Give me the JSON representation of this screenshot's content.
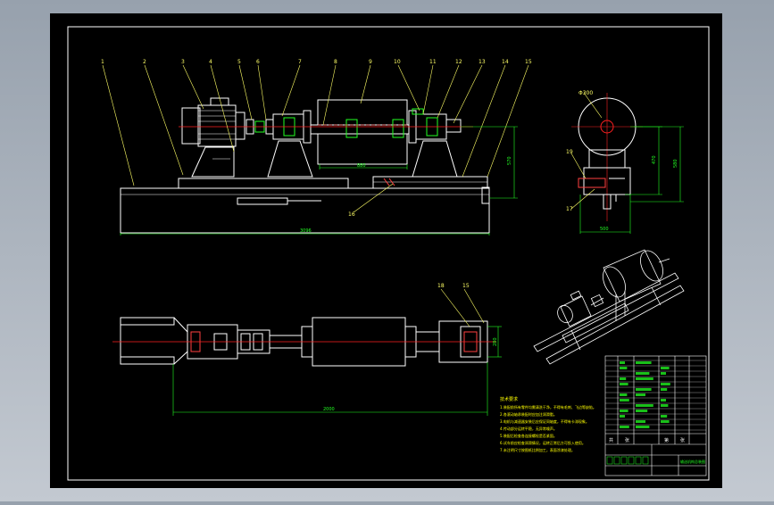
{
  "colors": {
    "background": "#9aa3ae",
    "sheet": "#000000",
    "line": "#ffffff",
    "centerline": "#ff2020",
    "leader": "#ffff66",
    "dimension": "#22ff22",
    "annotation": "#ffff00"
  },
  "drawing": {
    "balloons": [
      "1",
      "2",
      "3",
      "4",
      "5",
      "6",
      "7",
      "8",
      "9",
      "10",
      "11",
      "12",
      "13",
      "14",
      "15"
    ],
    "side_balloons": [
      "19",
      "17"
    ],
    "plan_balloons": [
      "18",
      "15"
    ],
    "lower_balloon": "16",
    "top_label": "Φ300",
    "dims": {
      "overall_length": "3096",
      "drum_length": "880",
      "height_main": "570",
      "plan_length": "2000",
      "side_width": "500",
      "side_height_a": "470",
      "side_height_b": "580",
      "plan_width": "280"
    }
  },
  "notes": {
    "title": "技术要求",
    "lines": [
      "1.装配前所有零件均需清洗干净，不得有毛刺、飞边等缺陷。",
      "2.各滚动轴承装配时应加注润滑脂。",
      "3.电机与减速器安装后应保证同轴度，不得有卡滞现象。",
      "4.传动部分运转平稳，无异常噪声。",
      "5.装配后检查各连接螺栓是否紧固。",
      "6.试车前应检查润滑情况，运转正常后方可投入使用。",
      "7.未注明尺寸按图纸比例加工，表面涂漆处理。"
    ]
  },
  "title_block": {
    "name": "输送机构总装图",
    "scale_labels": [
      "共",
      "张",
      "第",
      "张"
    ]
  }
}
